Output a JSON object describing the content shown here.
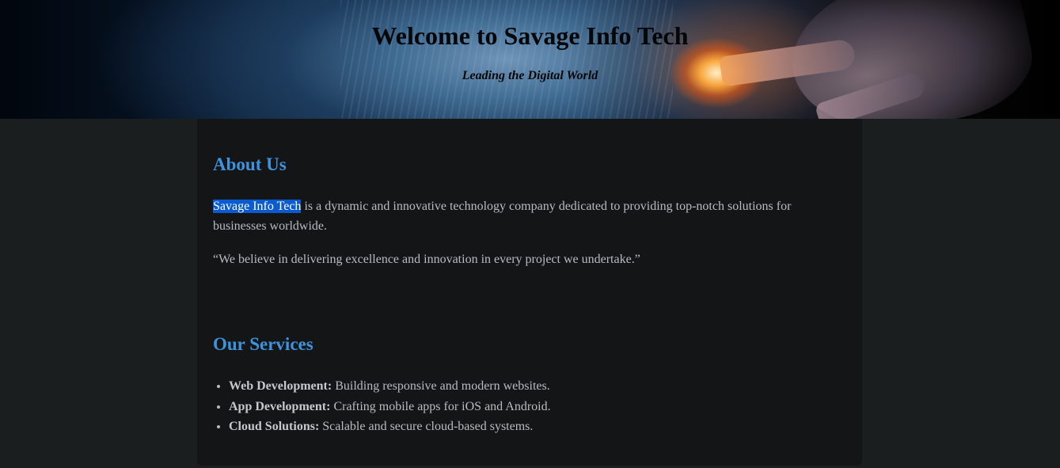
{
  "hero": {
    "title": "Welcome to Savage Info Tech",
    "tagline": "Leading the Digital World"
  },
  "about": {
    "heading": "About Us",
    "highlight": "Savage Info Tech",
    "paragraph": " is a dynamic and innovative technology company dedicated to providing top-notch solutions for businesses worldwide.",
    "quote": "“We believe in delivering excellence and innovation in every project we undertake.”"
  },
  "services": {
    "heading": "Our Services",
    "items": [
      {
        "title": "Web Development:",
        "desc": " Building responsive and modern websites."
      },
      {
        "title": "App Development:",
        "desc": " Crafting mobile apps for iOS and Android."
      },
      {
        "title": "Cloud Solutions:",
        "desc": " Scalable and secure cloud-based systems."
      }
    ]
  },
  "colors": {
    "accent": "#3e93dd",
    "page_bg": "#1a1e1f",
    "card_bg": "#131517",
    "selection": "#0a5ad1"
  }
}
